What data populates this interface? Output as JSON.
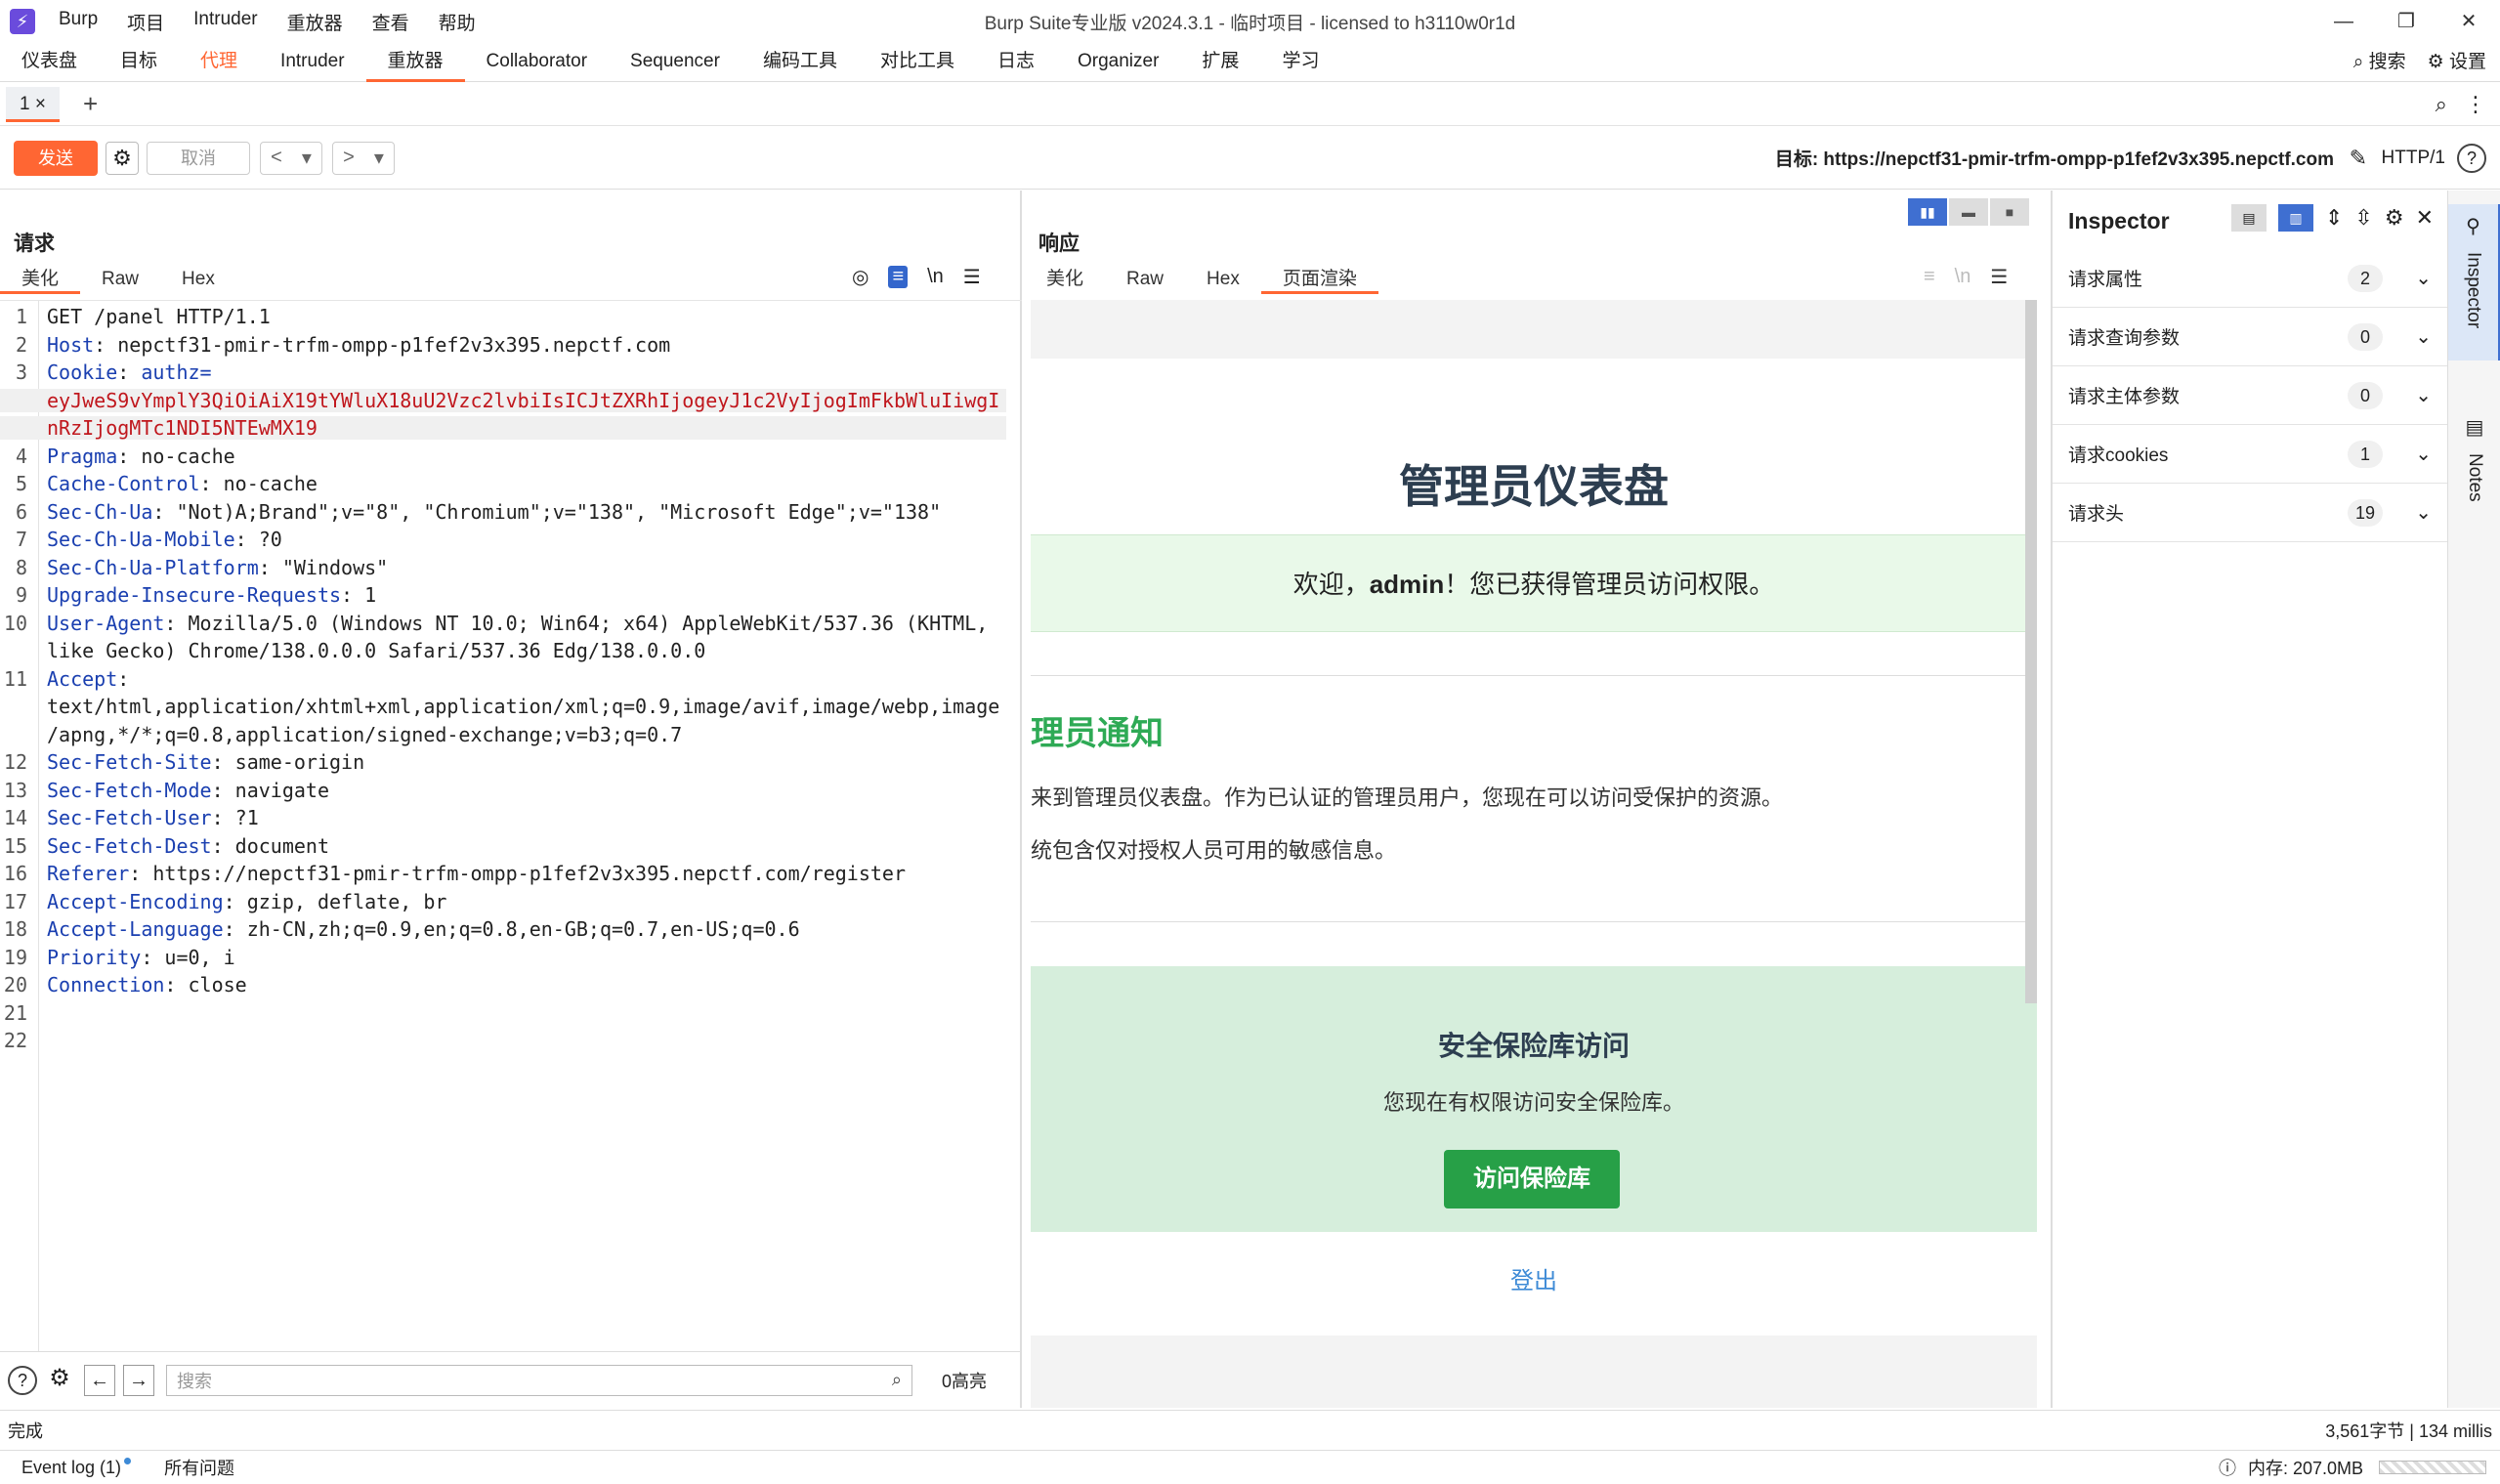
{
  "titlebar": {
    "logo": "⚡",
    "menu": [
      "Burp",
      "项目",
      "Intruder",
      "重放器",
      "查看",
      "帮助"
    ],
    "window_title": "Burp Suite专业版  v2024.3.1 - 临时项目 - licensed to h3110w0r1d",
    "controls": [
      "—",
      "❐",
      "✕"
    ]
  },
  "maintabs": {
    "items": [
      "仪表盘",
      "目标",
      "代理",
      "Intruder",
      "重放器",
      "Collaborator",
      "Sequencer",
      "编码工具",
      "对比工具",
      "日志",
      "Organizer",
      "扩展",
      "学习"
    ],
    "search": "搜索",
    "settings": "设置"
  },
  "subtabs": {
    "tab_label": "1 ×",
    "add": "+"
  },
  "toolbar": {
    "send": "发送",
    "cancel": "取消",
    "target": "目标: https://nepctf31-pmir-trfm-ompp-p1fef2v3x395.nepctf.com",
    "protocol": "HTTP/1",
    "help": "?"
  },
  "request": {
    "title": "请求",
    "tabs": [
      "美化",
      "Raw",
      "Hex"
    ],
    "icons": [
      "hide-icon",
      "wrap-icon",
      "newline-icon",
      "menu-icon"
    ],
    "newline_label": "\\n",
    "lines": [
      {
        "n": "1",
        "k": "",
        "v": "GET /panel HTTP/1.1"
      },
      {
        "n": "2",
        "k": "Host",
        "v": ": nepctf31-pmir-trfm-ompp-p1fef2v3x395.nepctf.com"
      },
      {
        "n": "3",
        "k": "Cookie",
        "v": ": ",
        "extra": "authz="
      },
      {
        "n": "",
        "red": "eyJweS9vYmplY3QiOiAiX19tYWluX18uU2Vzc2lvbiIsICJtZXRhIjogeyJ1c2VyIjogImFkbWluIiwgI"
      },
      {
        "n": "",
        "red": "nRzIjogMTc1NDI5NTEwMX19"
      },
      {
        "n": "4",
        "k": "Pragma",
        "v": ": no-cache"
      },
      {
        "n": "5",
        "k": "Cache-Control",
        "v": ": no-cache"
      },
      {
        "n": "6",
        "k": "Sec-Ch-Ua",
        "v": ": \"Not)A;Brand\";v=\"8\", \"Chromium\";v=\"138\", \"Microsoft Edge\";v=\"138\""
      },
      {
        "n": "7",
        "k": "Sec-Ch-Ua-Mobile",
        "v": ": ?0"
      },
      {
        "n": "8",
        "k": "Sec-Ch-Ua-Platform",
        "v": ": \"Windows\""
      },
      {
        "n": "9",
        "k": "Upgrade-Insecure-Requests",
        "v": ": 1"
      },
      {
        "n": "10",
        "k": "User-Agent",
        "v": ": Mozilla/5.0 (Windows NT 10.0; Win64; x64) AppleWebKit/537.36 (KHTML,"
      },
      {
        "n": "",
        "v": "like Gecko) Chrome/138.0.0.0 Safari/537.36 Edg/138.0.0.0"
      },
      {
        "n": "11",
        "k": "Accept",
        "v": ":"
      },
      {
        "n": "",
        "v": "text/html,application/xhtml+xml,application/xml;q=0.9,image/avif,image/webp,image"
      },
      {
        "n": "",
        "v": "/apng,*/*;q=0.8,application/signed-exchange;v=b3;q=0.7"
      },
      {
        "n": "12",
        "k": "Sec-Fetch-Site",
        "v": ": same-origin"
      },
      {
        "n": "13",
        "k": "Sec-Fetch-Mode",
        "v": ": navigate"
      },
      {
        "n": "14",
        "k": "Sec-Fetch-User",
        "v": ": ?1"
      },
      {
        "n": "15",
        "k": "Sec-Fetch-Dest",
        "v": ": document"
      },
      {
        "n": "16",
        "k": "Referer",
        "v": ": https://nepctf31-pmir-trfm-ompp-p1fef2v3x395.nepctf.com/register"
      },
      {
        "n": "17",
        "k": "Accept-Encoding",
        "v": ": gzip, deflate, br"
      },
      {
        "n": "18",
        "k": "Accept-Language",
        "v": ": zh-CN,zh;q=0.9,en;q=0.8,en-GB;q=0.7,en-US;q=0.6"
      },
      {
        "n": "19",
        "k": "Priority",
        "v": ": u=0, i"
      },
      {
        "n": "20",
        "k": "Connection",
        "v": ": close"
      },
      {
        "n": "21",
        "v": ""
      },
      {
        "n": "22",
        "v": ""
      }
    ],
    "footer": {
      "search_placeholder": "搜索",
      "hits": "0高亮"
    }
  },
  "response": {
    "title": "响应",
    "tabs": [
      "美化",
      "Raw",
      "Hex",
      "页面渲染"
    ],
    "render": {
      "heading": "管理员仪表盘",
      "welcome_pre": "欢迎，",
      "welcome_user": "admin",
      "welcome_post": "！您已获得管理员访问权限。",
      "notice_title": "理员通知",
      "notice_p1": "来到管理员仪表盘。作为已认证的管理员用户，您现在可以访问受保护的资源。",
      "notice_p2": "统包含仅对授权人员可用的敏感信息。",
      "vault_title": "安全保险库访问",
      "vault_desc": "您现在有权限访问安全保险库。",
      "vault_button": "访问保险库",
      "logout": "登出"
    }
  },
  "inspector": {
    "title": "Inspector",
    "rows": [
      {
        "label": "请求属性",
        "count": "2"
      },
      {
        "label": "请求查询参数",
        "count": "0"
      },
      {
        "label": "请求主体参数",
        "count": "0"
      },
      {
        "label": "请求cookies",
        "count": "1"
      },
      {
        "label": "请求头",
        "count": "19"
      }
    ]
  },
  "sidebar": {
    "items": [
      "Inspector",
      "Notes"
    ]
  },
  "status": {
    "left": "完成",
    "right": "3,561字节 | 134 millis"
  },
  "bottom": {
    "event_log": "Event log (1)",
    "issues": "所有问题",
    "memory": "内存: 207.0MB"
  },
  "colors": {
    "accent": "#ff6633",
    "key": "#1a3fb0",
    "cookie": "#c0171d",
    "success": "#2eaa55"
  }
}
